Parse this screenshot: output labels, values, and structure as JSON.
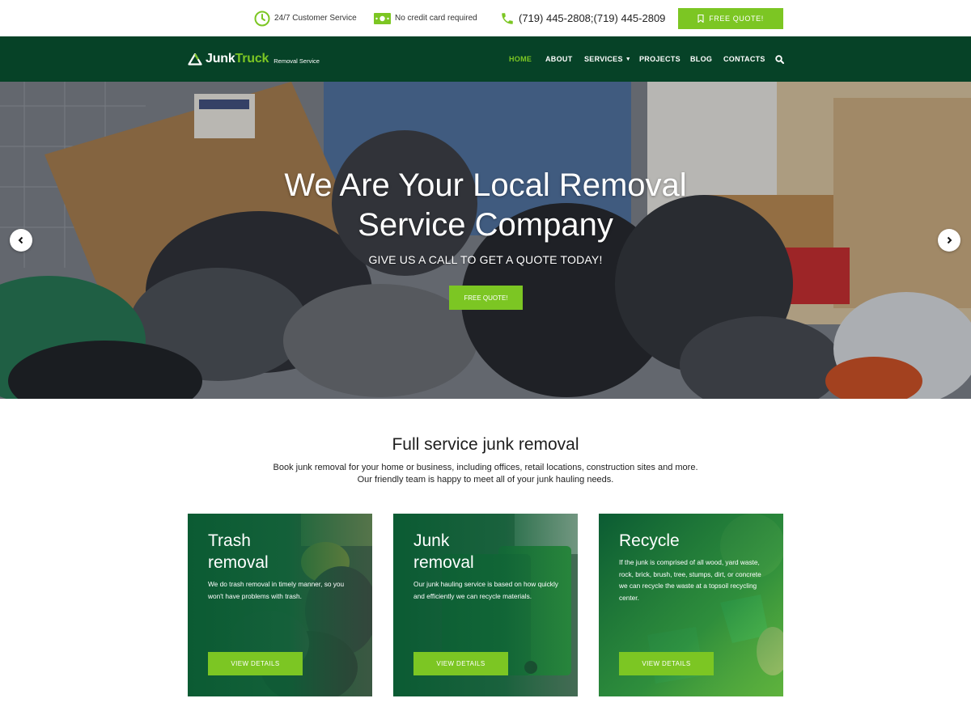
{
  "topbar": {
    "service_hours": "24/7 Customer Service",
    "no_card": "No credit card required",
    "phone": "(719) 445-2808;(719) 445-2809",
    "quote_button": "FREE QUOTE!"
  },
  "brand": {
    "name_part1": "Junk",
    "name_part2": "Truck",
    "tagline": "Removal Service"
  },
  "nav": {
    "home": "HOME",
    "about": "ABOUT",
    "services": "SERVICES",
    "projects": "PROJECTS",
    "blog": "BLOG",
    "contacts": "CONTACTS"
  },
  "hero": {
    "title_line1": "We Are Your Local Removal",
    "title_line2": "Service Company",
    "subtitle": "GIVE US A CALL TO GET A QUOTE TODAY!",
    "button": "FREE QUOTE!"
  },
  "intro": {
    "title": "Full service junk removal",
    "desc_line1": "Book junk removal for your home or business, including offices, retail locations, construction sites and more.",
    "desc_line2": "Our friendly team is happy to meet all of your junk hauling needs."
  },
  "cards": [
    {
      "title_line1": "Trash",
      "title_line2": "removal",
      "text": "We do trash removal in timely manner, so you won't have problems with trash.",
      "button": "VIEW DETAILS"
    },
    {
      "title_line1": "Junk",
      "title_line2": "removal",
      "text": "Our junk hauling service is based on how quickly and efficiently we can recycle materials.",
      "button": "VIEW DETAILS"
    },
    {
      "title_line1": "Recycle",
      "text": "If the junk is comprised of all wood, yard waste, rock, brick, brush, tree, stumps, dirt, or concrete we can recycle the waste at a topsoil recycling center.",
      "button": "VIEW DETAILS"
    }
  ],
  "colors": {
    "accent": "#7cc623",
    "nav_bg": "#064227",
    "card_green": "#0b5b33"
  },
  "icons": {
    "clock": "clock-icon",
    "cash": "cash-icon",
    "phone": "phone-icon",
    "bookmark": "bookmark-icon",
    "logo": "recycle-logo-icon",
    "search": "search-icon",
    "prev": "chevron-left-icon",
    "next": "chevron-right-icon"
  }
}
